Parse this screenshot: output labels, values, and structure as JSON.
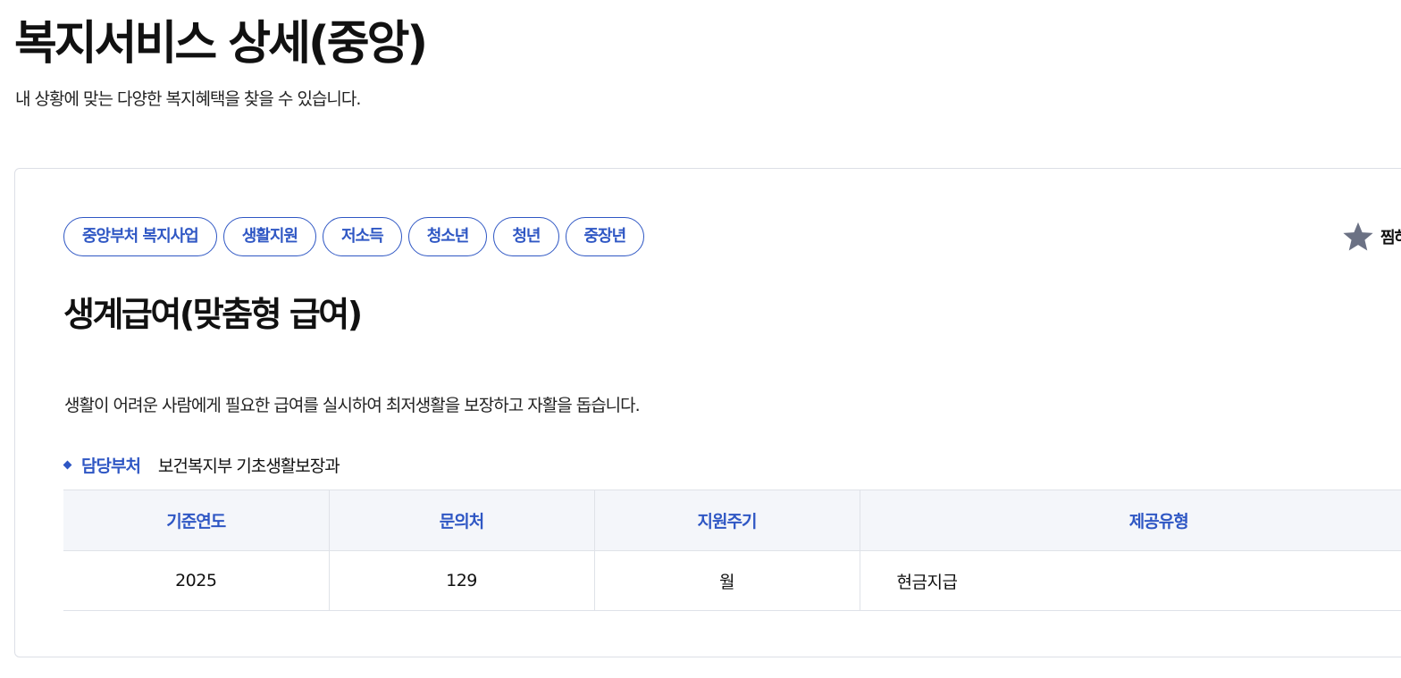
{
  "header": {
    "title": "복지서비스 상세(중앙)",
    "subtitle": "내 상황에 맞는 다양한 복지혜택을 찾을 수 있습니다."
  },
  "service": {
    "tags": [
      "중앙부처 복지사업",
      "생활지원",
      "저소득",
      "청소년",
      "청년",
      "중장년"
    ],
    "bookmark_label": "찜하기",
    "bookmark_icon": "star-icon",
    "title": "생계급여(맞춤형 급여)",
    "description": "생활이 어려운 사람에게 필요한 급여를 실시하여 최저생활을 보장하고 자활을 돕습니다.",
    "department": {
      "label": "담당부처",
      "value": "보건복지부 기초생활보장과"
    },
    "table": {
      "headers": [
        "기준연도",
        "문의처",
        "지원주기",
        "제공유형"
      ],
      "row": [
        "2025",
        "129",
        "월",
        "현금지급"
      ]
    }
  },
  "colors": {
    "accent": "#2f57c4",
    "table_header_bg": "#f4f6fa",
    "border": "#dcdfe6",
    "star": "#6b7184"
  }
}
